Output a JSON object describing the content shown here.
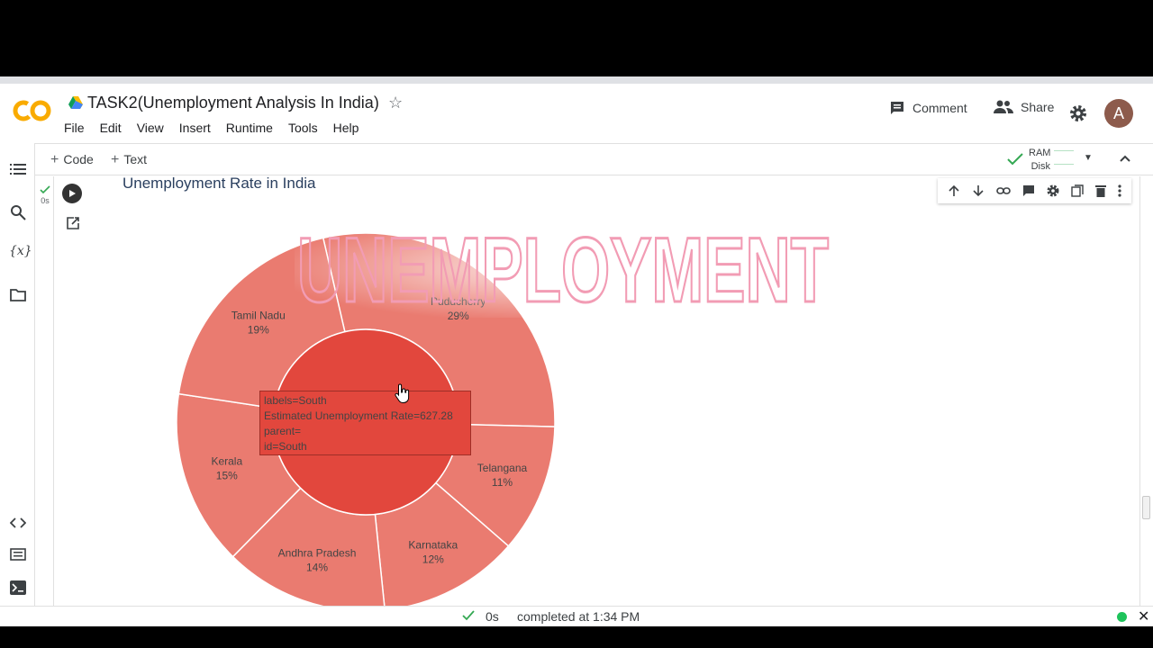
{
  "header": {
    "title": "TASK2(Unemployment Analysis In India)",
    "menu": [
      "File",
      "Edit",
      "View",
      "Insert",
      "Runtime",
      "Tools",
      "Help"
    ],
    "comment_label": "Comment",
    "share_label": "Share",
    "avatar_letter": "A",
    "logo_text": "CO"
  },
  "toolbar": {
    "code_label": "Code",
    "text_label": "Text",
    "ram_label": "RAM",
    "disk_label": "Disk"
  },
  "cell": {
    "exec_time": "0s"
  },
  "chart": {
    "title": "Unemployment Rate in India",
    "watermark": "UNEMPLOYMENT",
    "center_color": "#e2473d",
    "outer_color": "#ea7b70",
    "center_label": "South",
    "segments": [
      {
        "label": "Puducherry",
        "pct": "29%",
        "share": 0.29
      },
      {
        "label": "Telangana",
        "pct": "11%",
        "share": 0.11
      },
      {
        "label": "Karnataka",
        "pct": "12%",
        "share": 0.12
      },
      {
        "label": "Andhra Pradesh",
        "pct": "14%",
        "share": 0.14
      },
      {
        "label": "Kerala",
        "pct": "15%",
        "share": 0.15
      },
      {
        "label": "Tamil Nadu",
        "pct": "19%",
        "share": 0.19
      }
    ],
    "tooltip": [
      "labels=South",
      "Estimated Unemployment Rate=627.28",
      "parent=",
      "id=South"
    ]
  },
  "status": {
    "time": "0s",
    "completed": "completed at 1:34 PM"
  }
}
